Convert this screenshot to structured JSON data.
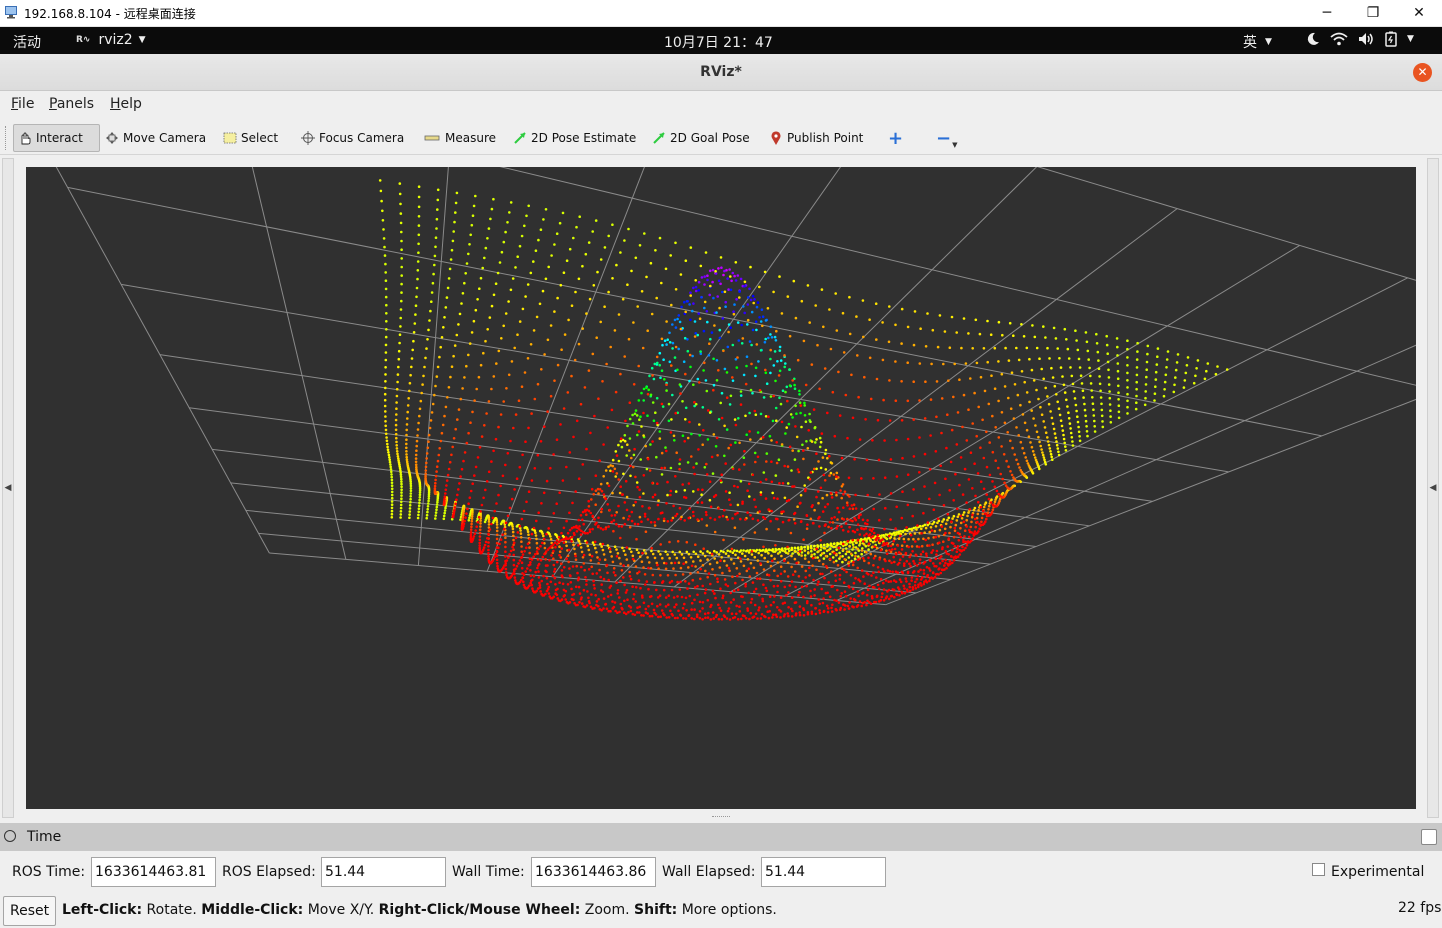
{
  "rdp_window": {
    "title": "192.168.8.104 - 远程桌面连接",
    "minimize_glyph": "─",
    "restore_glyph": "❐",
    "close_glyph": "✕"
  },
  "gnome_bar": {
    "activities": "活动",
    "app_name": "rviz2",
    "clock": "10月7日  21：47",
    "input_method": "英",
    "status_icons": [
      "night-light-icon",
      "wifi-icon",
      "volume-icon",
      "battery-icon"
    ]
  },
  "rviz": {
    "title": "RViz*",
    "menu": [
      {
        "label": "File",
        "underline": "F",
        "rest": "ile"
      },
      {
        "label": "Panels",
        "underline": "P",
        "rest": "anels"
      },
      {
        "label": "Help",
        "underline": "H",
        "rest": "elp"
      }
    ],
    "tools": {
      "interact": "Interact",
      "move_camera": "Move Camera",
      "select": "Select",
      "focus_camera": "Focus Camera",
      "measure": "Measure",
      "pose_estimate": "2D Pose Estimate",
      "goal_pose": "2D Goal Pose",
      "publish_point": "Publish Point",
      "add_tool": "+",
      "remove_tool": "−"
    },
    "colors": {
      "viewport_bg": "#303030",
      "grid_line": "#8a8a8a",
      "goal_green": "#2ecc40",
      "publish_point_red": "#c0392b",
      "close_orange": "#e95420"
    },
    "time_panel": {
      "title": "Time",
      "ros_time_label": "ROS Time:",
      "ros_time_value": "1633614463.81",
      "ros_elapsed_label": "ROS Elapsed:",
      "ros_elapsed_value": "51.44",
      "wall_time_label": "Wall Time:",
      "wall_time_value": "1633614463.86",
      "wall_elapsed_label": "Wall Elapsed:",
      "wall_elapsed_value": "51.44",
      "experimental_label": "Experimental",
      "experimental_checked": false
    },
    "status_bar": {
      "reset": "Reset",
      "hint_left_bold": "Left-Click:",
      "hint_left": " Rotate. ",
      "hint_middle_bold": "Middle-Click:",
      "hint_middle": " Move X/Y. ",
      "hint_right_bold": "Right-Click/Mouse Wheel:",
      "hint_right": " Zoom. ",
      "hint_shift_bold": "Shift:",
      "hint_shift": " More options.",
      "fps": "22 fps"
    }
  }
}
